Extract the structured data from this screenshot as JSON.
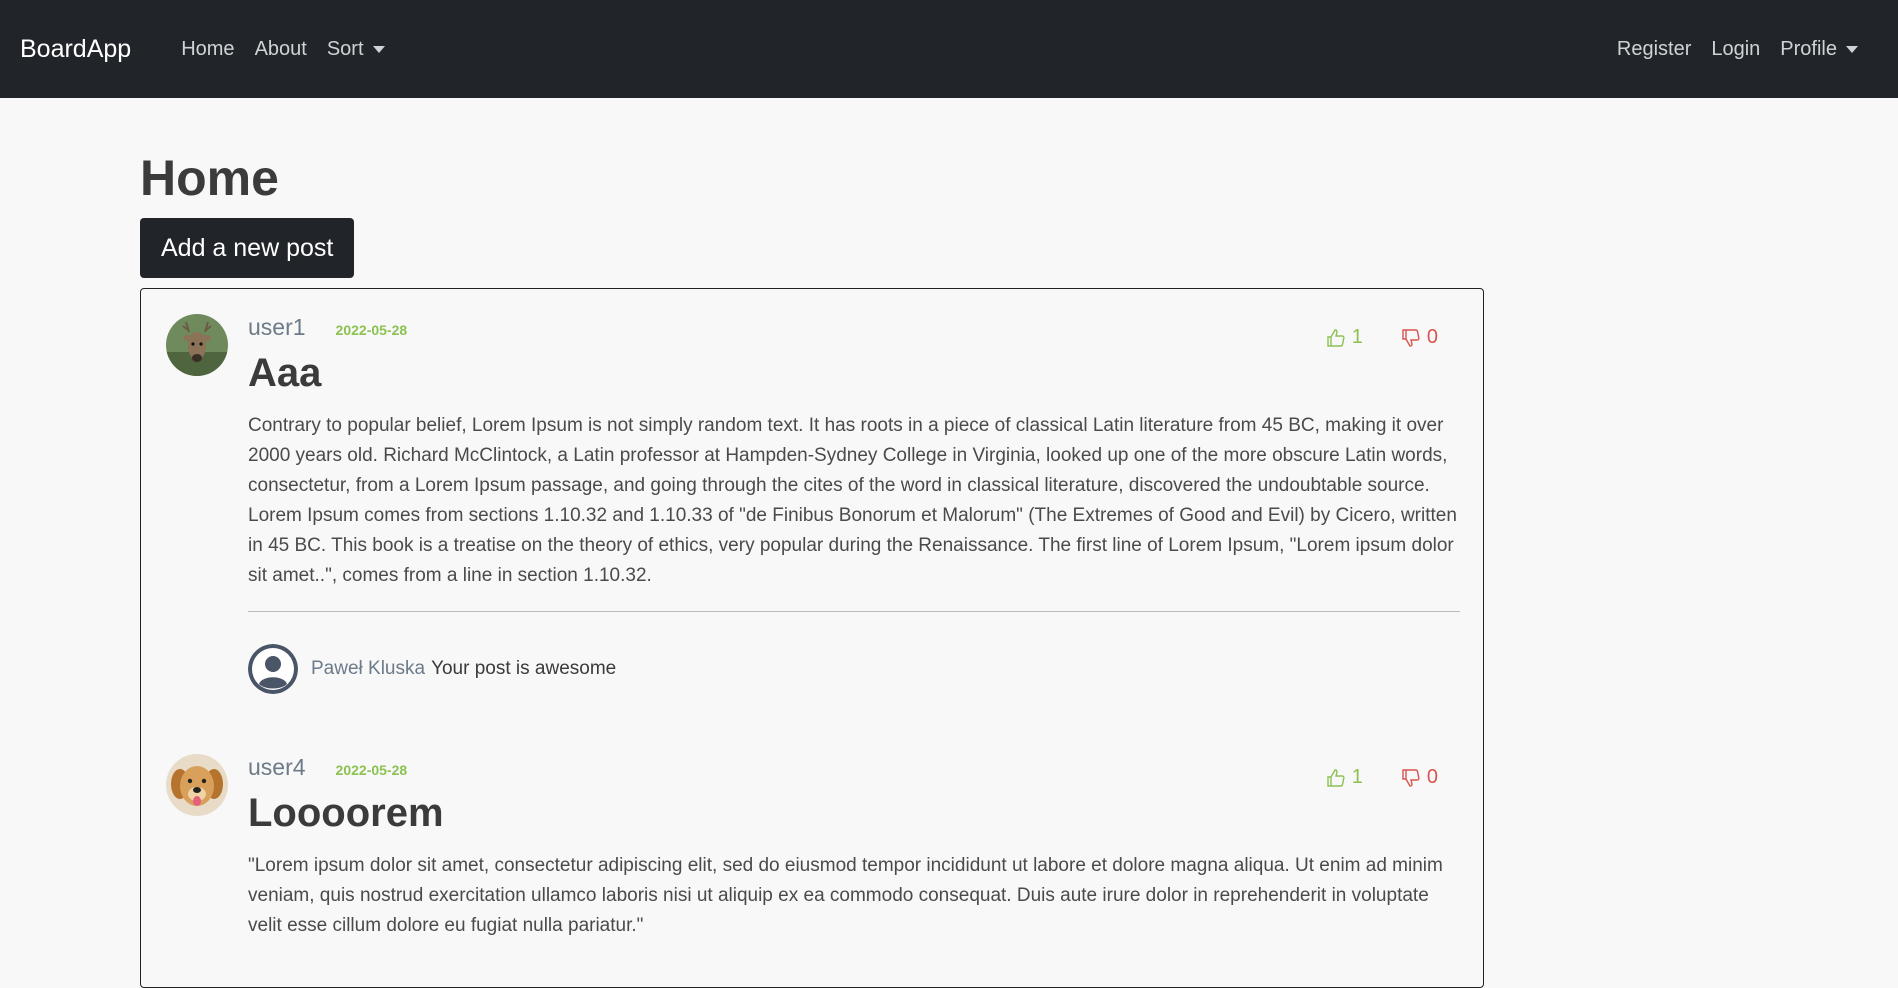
{
  "navbar": {
    "brand": "BoardApp",
    "links": [
      "Home",
      "About",
      "Sort"
    ],
    "right": [
      "Register",
      "Login",
      "Profile"
    ]
  },
  "page": {
    "title": "Home",
    "add_button": "Add a new post"
  },
  "posts": [
    {
      "user": "user1",
      "date": "2022-05-28",
      "title": "Aaa",
      "likes": "1",
      "dislikes": "0",
      "avatar_icon": "deer-avatar",
      "body": "Contrary to popular belief, Lorem Ipsum is not simply random text. It has roots in a piece of classical Latin literature from 45 BC, making it over 2000 years old. Richard McClintock, a Latin professor at Hampden-Sydney College in Virginia, looked up one of the more obscure Latin words, consectetur, from a Lorem Ipsum passage, and going through the cites of the word in classical literature, discovered the undoubtable source. Lorem Ipsum comes from sections 1.10.32 and 1.10.33 of \"de Finibus Bonorum et Malorum\" (The Extremes of Good and Evil) by Cicero, written in 45 BC. This book is a treatise on the theory of ethics, very popular during the Renaissance. The first line of Lorem Ipsum, \"Lorem ipsum dolor sit amet..\", comes from a line in section 1.10.32.",
      "comment": {
        "author": "Paweł Kluska",
        "text": "Your post is awesome",
        "avatar_icon": "default-user-avatar"
      }
    },
    {
      "user": "user4",
      "date": "2022-05-28",
      "title": "Loooorem",
      "likes": "1",
      "dislikes": "0",
      "avatar_icon": "dog-avatar",
      "body": "\"Lorem ipsum dolor sit amet, consectetur adipiscing elit, sed do eiusmod tempor incididunt ut labore et dolore magna aliqua. Ut enim ad minim veniam, quis nostrud exercitation ullamco laboris nisi ut aliquip ex ea commodo consequat. Duis aute irure dolor in reprehenderit in voluptate velit esse cillum dolore eu fugiat nulla pariatur.\""
    }
  ],
  "colors": {
    "navbar_bg": "#212529",
    "like": "#8cc152",
    "dislike": "#d9534f",
    "username": "#6c7a89"
  }
}
